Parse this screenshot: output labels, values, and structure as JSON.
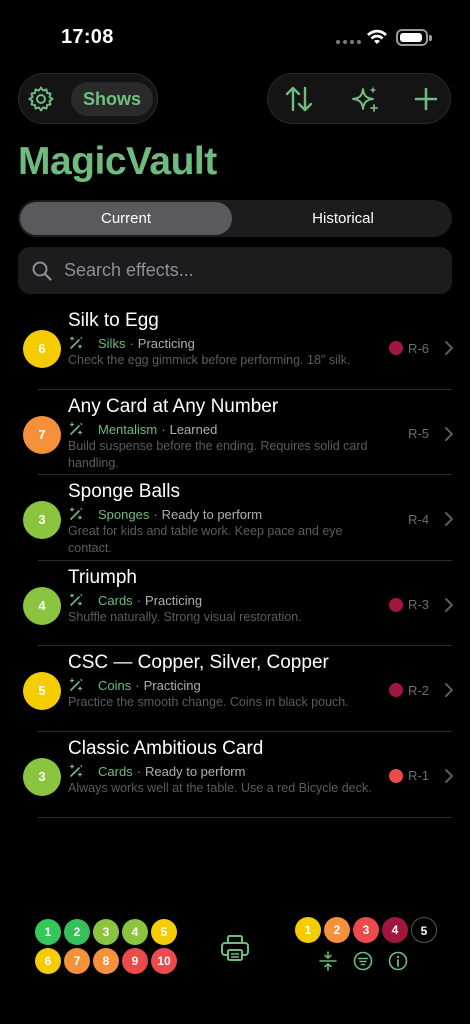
{
  "status_bar": {
    "time": "17:08"
  },
  "toolbar": {
    "shows_label": "Shows"
  },
  "app": {
    "title": "MagicVault"
  },
  "segments": {
    "current": "Current",
    "historical": "Historical",
    "selected": "Current"
  },
  "search": {
    "placeholder": "Search effects..."
  },
  "effects": [
    {
      "level": "6",
      "color": "#f5cc00",
      "title": "Silk to Egg",
      "category": "Silks",
      "status": "Practicing",
      "note": "Check the egg gimmick before performing. 18\" silk.",
      "code": "R-6",
      "mark_color": "#a0163e"
    },
    {
      "level": "7",
      "color": "#f4913a",
      "title": "Any Card at Any Number",
      "category": "Mentalism",
      "status": "Learned",
      "note": "Build suspense before the ending. Requires solid card handling.",
      "code": "R-5",
      "mark_color": ""
    },
    {
      "level": "3",
      "color": "#8bc53f",
      "title": "Sponge Balls",
      "category": "Sponges",
      "status": "Ready to perform",
      "note": "Great for kids and table work. Keep pace and eye contact.",
      "code": "R-4",
      "mark_color": ""
    },
    {
      "level": "4",
      "color": "#8bc53f",
      "title": "Triumph",
      "category": "Cards",
      "status": "Practicing",
      "note": "Shuffle naturally. Strong visual restoration.",
      "code": "R-3",
      "mark_color": "#a0163e"
    },
    {
      "level": "5",
      "color": "#f5cc00",
      "title": "CSC — Copper, Silver, Copper",
      "category": "Coins",
      "status": "Practicing",
      "note": "Practice the smooth change. Coins in black pouch.",
      "code": "R-2",
      "mark_color": "#a0163e"
    },
    {
      "level": "3",
      "color": "#8bc53f",
      "title": "Classic Ambitious Card",
      "category": "Cards",
      "status": "Ready to perform",
      "note": "Always works well at the table. Use a red Bicycle deck.",
      "code": "R-1",
      "mark_color": "#ec4b4b"
    }
  ],
  "difficulty_legend": [
    {
      "n": "1",
      "color": "#34c759"
    },
    {
      "n": "2",
      "color": "#36c05a"
    },
    {
      "n": "3",
      "color": "#8bc53f"
    },
    {
      "n": "4",
      "color": "#8bc53f"
    },
    {
      "n": "5",
      "color": "#f5cc00"
    },
    {
      "n": "6",
      "color": "#f5cc00"
    },
    {
      "n": "7",
      "color": "#f4913a"
    },
    {
      "n": "8",
      "color": "#f4913a"
    },
    {
      "n": "9",
      "color": "#ec4b4b"
    },
    {
      "n": "10",
      "color": "#ec4b4b"
    }
  ],
  "rating_legend": [
    {
      "n": "1",
      "color": "#f5cc00"
    },
    {
      "n": "2",
      "color": "#f4913a"
    },
    {
      "n": "3",
      "color": "#ec4b4b"
    },
    {
      "n": "4",
      "color": "#a0163e"
    },
    {
      "n": "5",
      "color": "#000000"
    }
  ]
}
